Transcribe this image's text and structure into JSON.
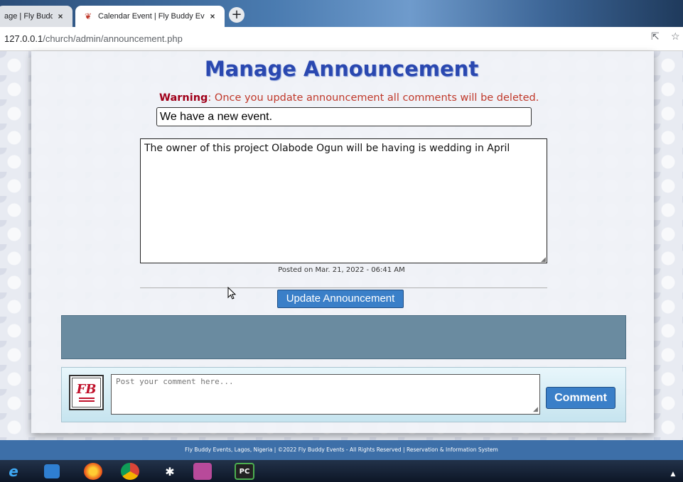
{
  "browser": {
    "tabs": [
      {
        "title": "age | Fly Buddy",
        "close": "×"
      },
      {
        "title": "Calendar Event | Fly Buddy Event",
        "close": "×"
      }
    ],
    "new_tab_label": "+",
    "url_host": "127.0.0.1",
    "url_path": "/church/admin/announcement.php"
  },
  "main": {
    "title": "Manage Announcement",
    "warning_label": "Warning",
    "warning_text": ": Once you update announcement all comments will be deleted.",
    "subject_value": "We have a new event.",
    "body_value": "The owner of this project Olabode Ogun will be having is wedding in April",
    "posted_text": "Posted on Mar. 21, 2022 - 06:41 AM",
    "update_button": "Update Announcement"
  },
  "comment": {
    "avatar_text": "FB",
    "placeholder": "Post your comment here...",
    "button": "Comment"
  },
  "footer": {
    "text": "Fly Buddy Events, Lagos, Nigeria | ©2022 Fly Buddy Events - All Rights Reserved | Reservation & Information System"
  },
  "taskbar": {
    "ie_glyph": "e",
    "bt_glyph": "✱",
    "pc_glyph": "PC",
    "tray_glyph": "▲"
  },
  "colors": {
    "accent": "#3a7fc8",
    "title": "#2a48b0",
    "warning": "#c0392b",
    "footer": "#3d6fa8"
  }
}
